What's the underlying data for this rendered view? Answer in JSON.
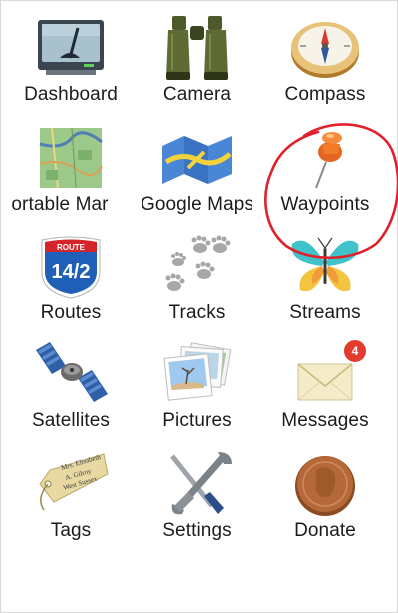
{
  "menu": {
    "items": [
      {
        "label": "Dashboard",
        "icon": "dashboard-icon"
      },
      {
        "label": "Camera",
        "icon": "binoculars-icon"
      },
      {
        "label": "Compass",
        "icon": "compass-icon"
      },
      {
        "label": "ortable Mar",
        "icon": "portable-map-icon"
      },
      {
        "label": "Google Maps",
        "icon": "google-maps-icon"
      },
      {
        "label": "Waypoints",
        "icon": "pushpin-icon"
      },
      {
        "label": "Routes",
        "icon": "route-shield-icon"
      },
      {
        "label": "Tracks",
        "icon": "footprints-icon"
      },
      {
        "label": "Streams",
        "icon": "butterfly-icon"
      },
      {
        "label": "Satellites",
        "icon": "satellite-icon"
      },
      {
        "label": "Pictures",
        "icon": "photos-icon"
      },
      {
        "label": "Messages",
        "icon": "envelope-icon"
      },
      {
        "label": "Tags",
        "icon": "luggage-tag-icon"
      },
      {
        "label": "Settings",
        "icon": "tools-icon"
      },
      {
        "label": "Donate",
        "icon": "penny-coin-icon"
      }
    ]
  },
  "routes_shield": {
    "top": "ROUTE",
    "number": "14/2"
  },
  "messages_badge": "4",
  "tag_text": {
    "line1": "Mrs. Elisabeth",
    "line2": "A. Gilroy",
    "line3": "West Sussex"
  },
  "annotation": {
    "color": "#e0202a",
    "target": "Waypoints"
  }
}
